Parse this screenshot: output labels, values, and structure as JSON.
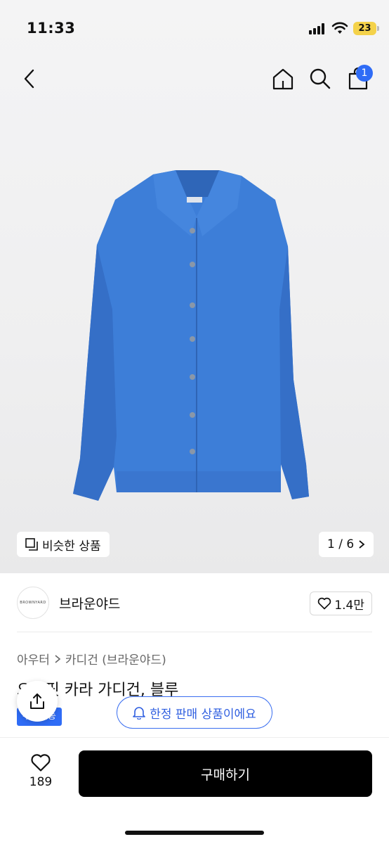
{
  "status": {
    "time": "11:33",
    "battery": "23"
  },
  "nav": {
    "cart_badge": "1"
  },
  "gallery": {
    "similar_label": "비슷한 상품",
    "pager": "1 / 6"
  },
  "brand": {
    "logo_text": "BROWNYARD",
    "name": "브라운야드",
    "likes": "1.4만"
  },
  "breadcrumb": {
    "category": "아우터",
    "subcategory": "카디건 (브라운야드)"
  },
  "product": {
    "title": "오버핏 카라 가디건, 블루",
    "tag": "무료배송"
  },
  "toast": {
    "text": "한정 판매 상품이에요"
  },
  "bottom": {
    "wish_count": "189",
    "buy_label": "구매하기"
  },
  "colors": {
    "accent": "#2f6cf6",
    "cardigan": "#3d7ed8",
    "buy_button": "#000000"
  },
  "icons": [
    "back-arrow-icon",
    "home-icon",
    "search-icon",
    "bag-icon",
    "copy-icon",
    "chevron-right-icon",
    "heart-icon",
    "share-icon",
    "bell-icon"
  ]
}
